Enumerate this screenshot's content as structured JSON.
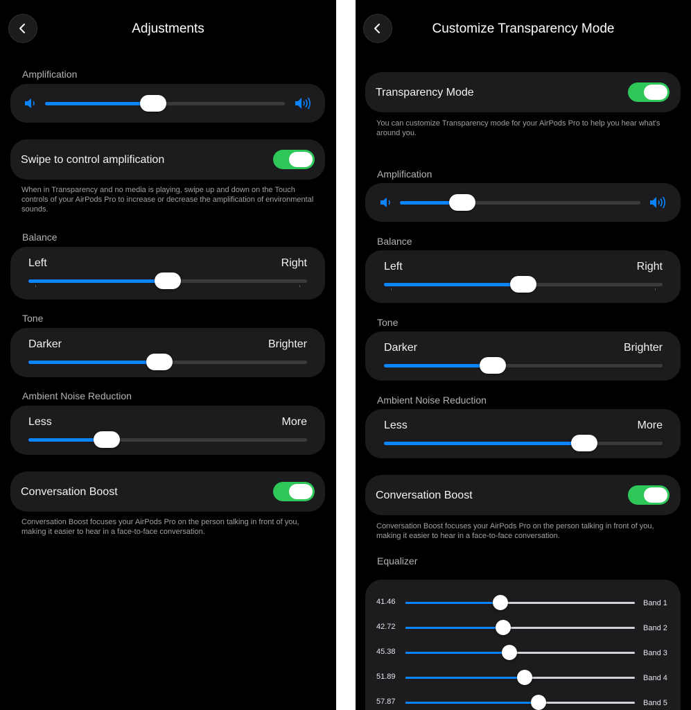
{
  "left_screen": {
    "title": "Adjustments",
    "amplification": {
      "section": "Amplification",
      "value": 0.45
    },
    "swipe": {
      "label": "Swipe to control amplification",
      "on": true,
      "note": "When in Transparency and no media is playing, swipe up and down on the Touch controls of your AirPods Pro to increase or decrease the amplification of environmental sounds."
    },
    "balance": {
      "section": "Balance",
      "min_label": "Left",
      "max_label": "Right",
      "value": 0.5
    },
    "tone": {
      "section": "Tone",
      "min_label": "Darker",
      "max_label": "Brighter",
      "value": 0.47
    },
    "noise": {
      "section": "Ambient Noise Reduction",
      "min_label": "Less",
      "max_label": "More",
      "value": 0.28
    },
    "boost": {
      "label": "Conversation Boost",
      "on": true,
      "note": "Conversation Boost focuses your AirPods Pro on the person talking in front of you, making it easier to hear in a face-to-face conversation."
    }
  },
  "right_screen": {
    "title": "Customize Transparency Mode",
    "transparency": {
      "label": "Transparency Mode",
      "on": true,
      "note": "You can customize Transparency mode for your AirPods Pro to help you hear what's around you."
    },
    "amplification": {
      "section": "Amplification",
      "value": 0.26
    },
    "balance": {
      "section": "Balance",
      "min_label": "Left",
      "max_label": "Right",
      "value": 0.5
    },
    "tone": {
      "section": "Tone",
      "min_label": "Darker",
      "max_label": "Brighter",
      "value": 0.39
    },
    "noise": {
      "section": "Ambient Noise Reduction",
      "min_label": "Less",
      "max_label": "More",
      "value": 0.72
    },
    "boost": {
      "label": "Conversation Boost",
      "on": true,
      "note": "Conversation Boost focuses your AirPods Pro on the person talking in front of you, making it easier to hear in a face-to-face conversation."
    },
    "equalizer": {
      "section": "Equalizer",
      "bands": [
        {
          "value": "41.46",
          "label": "Band 1",
          "level": 0.4146
        },
        {
          "value": "42.72",
          "label": "Band 2",
          "level": 0.4272
        },
        {
          "value": "45.38",
          "label": "Band 3",
          "level": 0.4538
        },
        {
          "value": "51.89",
          "label": "Band 4",
          "level": 0.5189
        },
        {
          "value": "57.87",
          "label": "Band 5",
          "level": 0.5787
        }
      ]
    }
  },
  "icons": {
    "back": "chevron-left-icon",
    "speaker_low": "speaker-low-icon",
    "speaker_high": "speaker-high-icon"
  },
  "colors": {
    "accent": "#0a84ff",
    "toggle_on": "#30c759",
    "card": "#1c1c1e",
    "background": "#000000"
  }
}
